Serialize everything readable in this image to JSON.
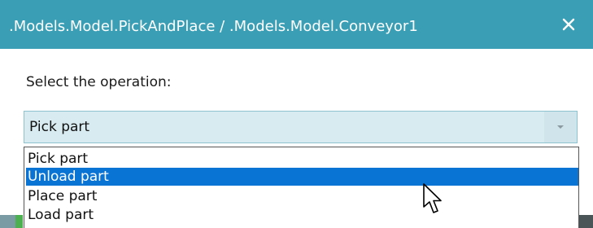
{
  "dialog": {
    "title": ".Models.Model.PickAndPlace / .Models.Model.Conveyor1",
    "close_icon": "close-icon"
  },
  "form": {
    "prompt": "Select the operation:",
    "combo_value": "Pick part",
    "combo_arrow_icon": "chevron-down-icon",
    "options": [
      {
        "label": "Pick part",
        "selected": false
      },
      {
        "label": "Unload part",
        "selected": true
      },
      {
        "label": "Place part",
        "selected": false
      },
      {
        "label": "Load part",
        "selected": false
      }
    ]
  },
  "colors": {
    "titlebar": "#3a9fb5",
    "combo_background": "#d7ebf1",
    "selection": "#0a74d5"
  }
}
